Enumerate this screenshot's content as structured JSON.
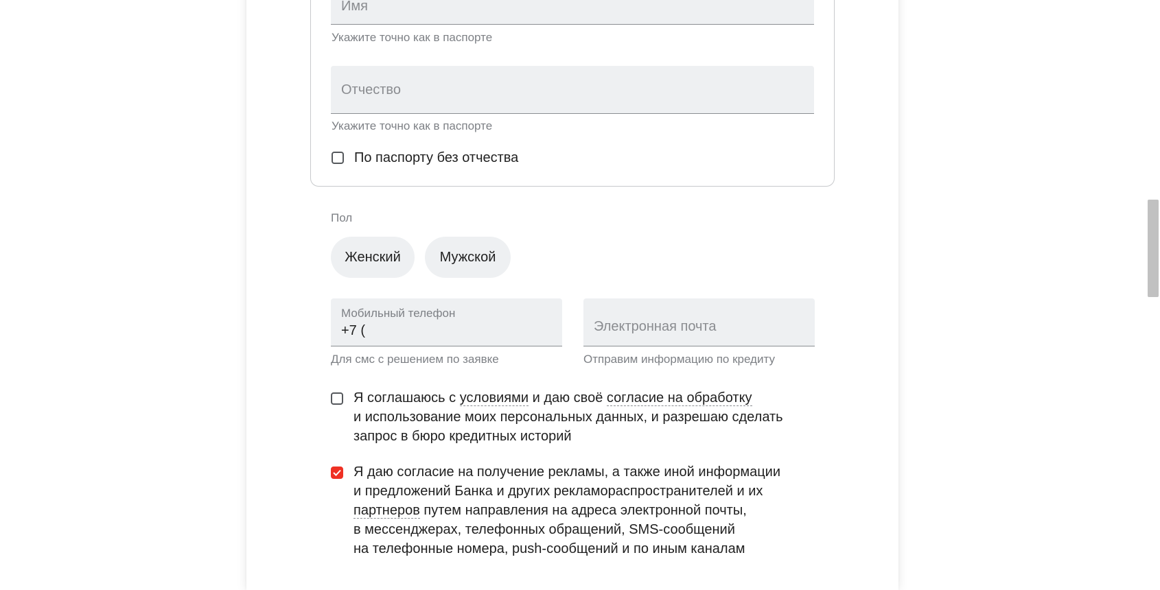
{
  "form": {
    "first_name": {
      "placeholder": "Имя",
      "hint": "Укажите точно как в паспорте"
    },
    "patronymic": {
      "placeholder": "Отчество",
      "hint": "Укажите точно как в паспорте"
    },
    "no_patronymic_label": "По паспорту без отчества",
    "gender": {
      "label": "Пол",
      "options": [
        "Женский",
        "Мужской"
      ]
    },
    "phone": {
      "label": "Мобильный телефон",
      "value": "+7 (",
      "hint": "Для смс с решением по заявке"
    },
    "email": {
      "placeholder": "Электронная почта",
      "hint": "Отправим информацию по кредиту"
    },
    "consent_terms": {
      "checked": false,
      "part1": "Я соглашаюсь с ",
      "link1": "условиями",
      "part2": " и даю своё ",
      "link2": "согласие на обработку",
      "line2": "и использование моих персональных данных, и разрешаю сделать",
      "line3": "запрос в бюро кредитных историй"
    },
    "consent_ads": {
      "checked": true,
      "line1": "Я даю согласие на получение рекламы, а также иной информации",
      "line2": "и предложений Банка и других рекламораспространителей и их",
      "link": "партнеров",
      "line3_rest": " путем направления на адреса электронной почты,",
      "line4": "в мессенджерах, телефонных обращений, SMS-сообщений",
      "line5": "на телефонные номера, push-сообщений и по иным каналам"
    }
  },
  "colors": {
    "accent": "#ef3124",
    "input_bg": "#eef0f2",
    "hint_text": "#7d8085"
  }
}
